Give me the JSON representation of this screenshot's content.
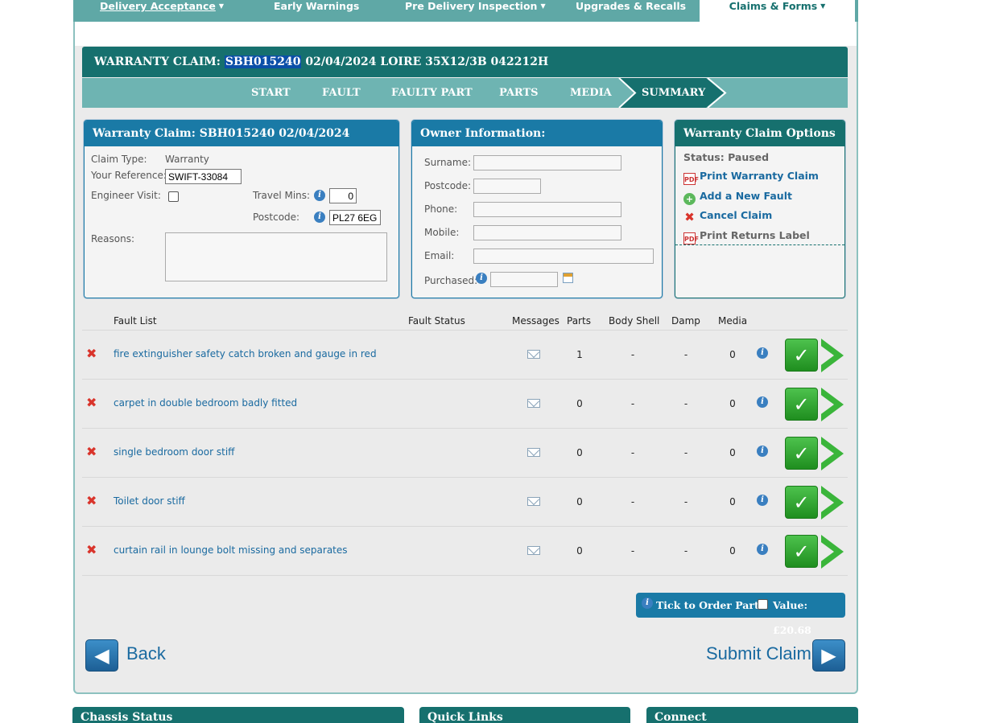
{
  "topnav": {
    "items": [
      "Delivery Acceptance",
      "Early Warnings",
      "Pre Delivery Inspection",
      "Upgrades & Recalls",
      "Claims & Forms"
    ]
  },
  "claim": {
    "title_prefix": "WARRANTY CLAIM:",
    "claim_id": "SBH015240",
    "title_rest": "02/04/2024 LOIRE 35X12/3B 042212H"
  },
  "steps": [
    "START",
    "FAULT",
    "FAULTY PART",
    "PARTS",
    "MEDIA",
    "SUMMARY"
  ],
  "claim_panel": {
    "title": "Warranty Claim: SBH015240 02/04/2024",
    "claim_type_label": "Claim Type:",
    "claim_type_value": "Warranty",
    "reference_label": "Your Reference:",
    "reference_value": "SWIFT-33084",
    "engineer_label": "Engineer Visit:",
    "travel_label": "Travel Mins:",
    "travel_value": "0",
    "postcode_label": "Postcode:",
    "postcode_value": "PL27 6EG",
    "reasons_label": "Reasons:"
  },
  "owner_panel": {
    "title": "Owner Information:",
    "surname": "Surname:",
    "postcode": "Postcode:",
    "phone": "Phone:",
    "mobile": "Mobile:",
    "email": "Email:",
    "purchased": "Purchased:"
  },
  "options_panel": {
    "title": "Warranty Claim Options",
    "status": "Status: Paused",
    "print_claim": "Print Warranty Claim",
    "add_fault": "Add a New Fault",
    "cancel": "Cancel Claim",
    "print_label": "Print Returns Label"
  },
  "faults": {
    "headers": [
      "Fault List",
      "Fault Status",
      "Messages",
      "Parts",
      "Body Shell",
      "Damp",
      "Media"
    ],
    "rows": [
      {
        "desc": "fire extinguisher safety catch broken and gauge in red",
        "parts": "1",
        "body": "-",
        "damp": "-",
        "media": "0"
      },
      {
        "desc": "carpet in double bedroom badly fitted",
        "parts": "0",
        "body": "-",
        "damp": "-",
        "media": "0"
      },
      {
        "desc": "single bedroom door stiff",
        "parts": "0",
        "body": "-",
        "damp": "-",
        "media": "0"
      },
      {
        "desc": "Toilet door stiff",
        "parts": "0",
        "body": "-",
        "damp": "-",
        "media": "0"
      },
      {
        "desc": "curtain rail in lounge bolt missing and separates",
        "parts": "0",
        "body": "-",
        "damp": "-",
        "media": "0"
      }
    ]
  },
  "order": {
    "tick_label": "Tick to Order Parts:",
    "value_label": "Value: £20.68"
  },
  "nav": {
    "back": "Back",
    "submit": "Submit Claim"
  },
  "bottom": [
    "Chassis Status",
    "Quick Links",
    "Connect"
  ]
}
